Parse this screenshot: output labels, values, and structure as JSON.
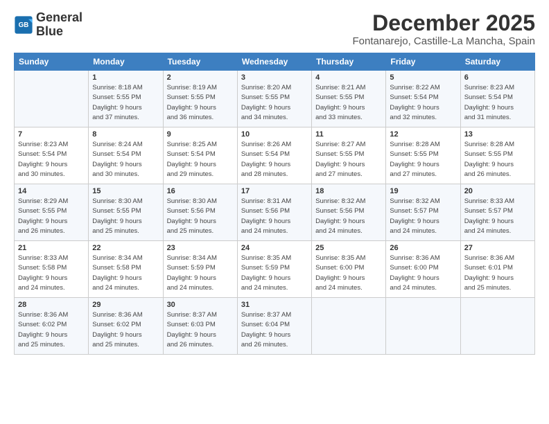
{
  "logo": {
    "line1": "General",
    "line2": "Blue"
  },
  "title": "December 2025",
  "location": "Fontanarejo, Castille-La Mancha, Spain",
  "weekdays": [
    "Sunday",
    "Monday",
    "Tuesday",
    "Wednesday",
    "Thursday",
    "Friday",
    "Saturday"
  ],
  "weeks": [
    [
      {
        "day": "",
        "info": ""
      },
      {
        "day": "1",
        "info": "Sunrise: 8:18 AM\nSunset: 5:55 PM\nDaylight: 9 hours\nand 37 minutes."
      },
      {
        "day": "2",
        "info": "Sunrise: 8:19 AM\nSunset: 5:55 PM\nDaylight: 9 hours\nand 36 minutes."
      },
      {
        "day": "3",
        "info": "Sunrise: 8:20 AM\nSunset: 5:55 PM\nDaylight: 9 hours\nand 34 minutes."
      },
      {
        "day": "4",
        "info": "Sunrise: 8:21 AM\nSunset: 5:55 PM\nDaylight: 9 hours\nand 33 minutes."
      },
      {
        "day": "5",
        "info": "Sunrise: 8:22 AM\nSunset: 5:54 PM\nDaylight: 9 hours\nand 32 minutes."
      },
      {
        "day": "6",
        "info": "Sunrise: 8:23 AM\nSunset: 5:54 PM\nDaylight: 9 hours\nand 31 minutes."
      }
    ],
    [
      {
        "day": "7",
        "info": "Sunrise: 8:23 AM\nSunset: 5:54 PM\nDaylight: 9 hours\nand 30 minutes."
      },
      {
        "day": "8",
        "info": "Sunrise: 8:24 AM\nSunset: 5:54 PM\nDaylight: 9 hours\nand 30 minutes."
      },
      {
        "day": "9",
        "info": "Sunrise: 8:25 AM\nSunset: 5:54 PM\nDaylight: 9 hours\nand 29 minutes."
      },
      {
        "day": "10",
        "info": "Sunrise: 8:26 AM\nSunset: 5:54 PM\nDaylight: 9 hours\nand 28 minutes."
      },
      {
        "day": "11",
        "info": "Sunrise: 8:27 AM\nSunset: 5:55 PM\nDaylight: 9 hours\nand 27 minutes."
      },
      {
        "day": "12",
        "info": "Sunrise: 8:28 AM\nSunset: 5:55 PM\nDaylight: 9 hours\nand 27 minutes."
      },
      {
        "day": "13",
        "info": "Sunrise: 8:28 AM\nSunset: 5:55 PM\nDaylight: 9 hours\nand 26 minutes."
      }
    ],
    [
      {
        "day": "14",
        "info": "Sunrise: 8:29 AM\nSunset: 5:55 PM\nDaylight: 9 hours\nand 26 minutes."
      },
      {
        "day": "15",
        "info": "Sunrise: 8:30 AM\nSunset: 5:55 PM\nDaylight: 9 hours\nand 25 minutes."
      },
      {
        "day": "16",
        "info": "Sunrise: 8:30 AM\nSunset: 5:56 PM\nDaylight: 9 hours\nand 25 minutes."
      },
      {
        "day": "17",
        "info": "Sunrise: 8:31 AM\nSunset: 5:56 PM\nDaylight: 9 hours\nand 24 minutes."
      },
      {
        "day": "18",
        "info": "Sunrise: 8:32 AM\nSunset: 5:56 PM\nDaylight: 9 hours\nand 24 minutes."
      },
      {
        "day": "19",
        "info": "Sunrise: 8:32 AM\nSunset: 5:57 PM\nDaylight: 9 hours\nand 24 minutes."
      },
      {
        "day": "20",
        "info": "Sunrise: 8:33 AM\nSunset: 5:57 PM\nDaylight: 9 hours\nand 24 minutes."
      }
    ],
    [
      {
        "day": "21",
        "info": "Sunrise: 8:33 AM\nSunset: 5:58 PM\nDaylight: 9 hours\nand 24 minutes."
      },
      {
        "day": "22",
        "info": "Sunrise: 8:34 AM\nSunset: 5:58 PM\nDaylight: 9 hours\nand 24 minutes."
      },
      {
        "day": "23",
        "info": "Sunrise: 8:34 AM\nSunset: 5:59 PM\nDaylight: 9 hours\nand 24 minutes."
      },
      {
        "day": "24",
        "info": "Sunrise: 8:35 AM\nSunset: 5:59 PM\nDaylight: 9 hours\nand 24 minutes."
      },
      {
        "day": "25",
        "info": "Sunrise: 8:35 AM\nSunset: 6:00 PM\nDaylight: 9 hours\nand 24 minutes."
      },
      {
        "day": "26",
        "info": "Sunrise: 8:36 AM\nSunset: 6:00 PM\nDaylight: 9 hours\nand 24 minutes."
      },
      {
        "day": "27",
        "info": "Sunrise: 8:36 AM\nSunset: 6:01 PM\nDaylight: 9 hours\nand 25 minutes."
      }
    ],
    [
      {
        "day": "28",
        "info": "Sunrise: 8:36 AM\nSunset: 6:02 PM\nDaylight: 9 hours\nand 25 minutes."
      },
      {
        "day": "29",
        "info": "Sunrise: 8:36 AM\nSunset: 6:02 PM\nDaylight: 9 hours\nand 25 minutes."
      },
      {
        "day": "30",
        "info": "Sunrise: 8:37 AM\nSunset: 6:03 PM\nDaylight: 9 hours\nand 26 minutes."
      },
      {
        "day": "31",
        "info": "Sunrise: 8:37 AM\nSunset: 6:04 PM\nDaylight: 9 hours\nand 26 minutes."
      },
      {
        "day": "",
        "info": ""
      },
      {
        "day": "",
        "info": ""
      },
      {
        "day": "",
        "info": ""
      }
    ]
  ]
}
